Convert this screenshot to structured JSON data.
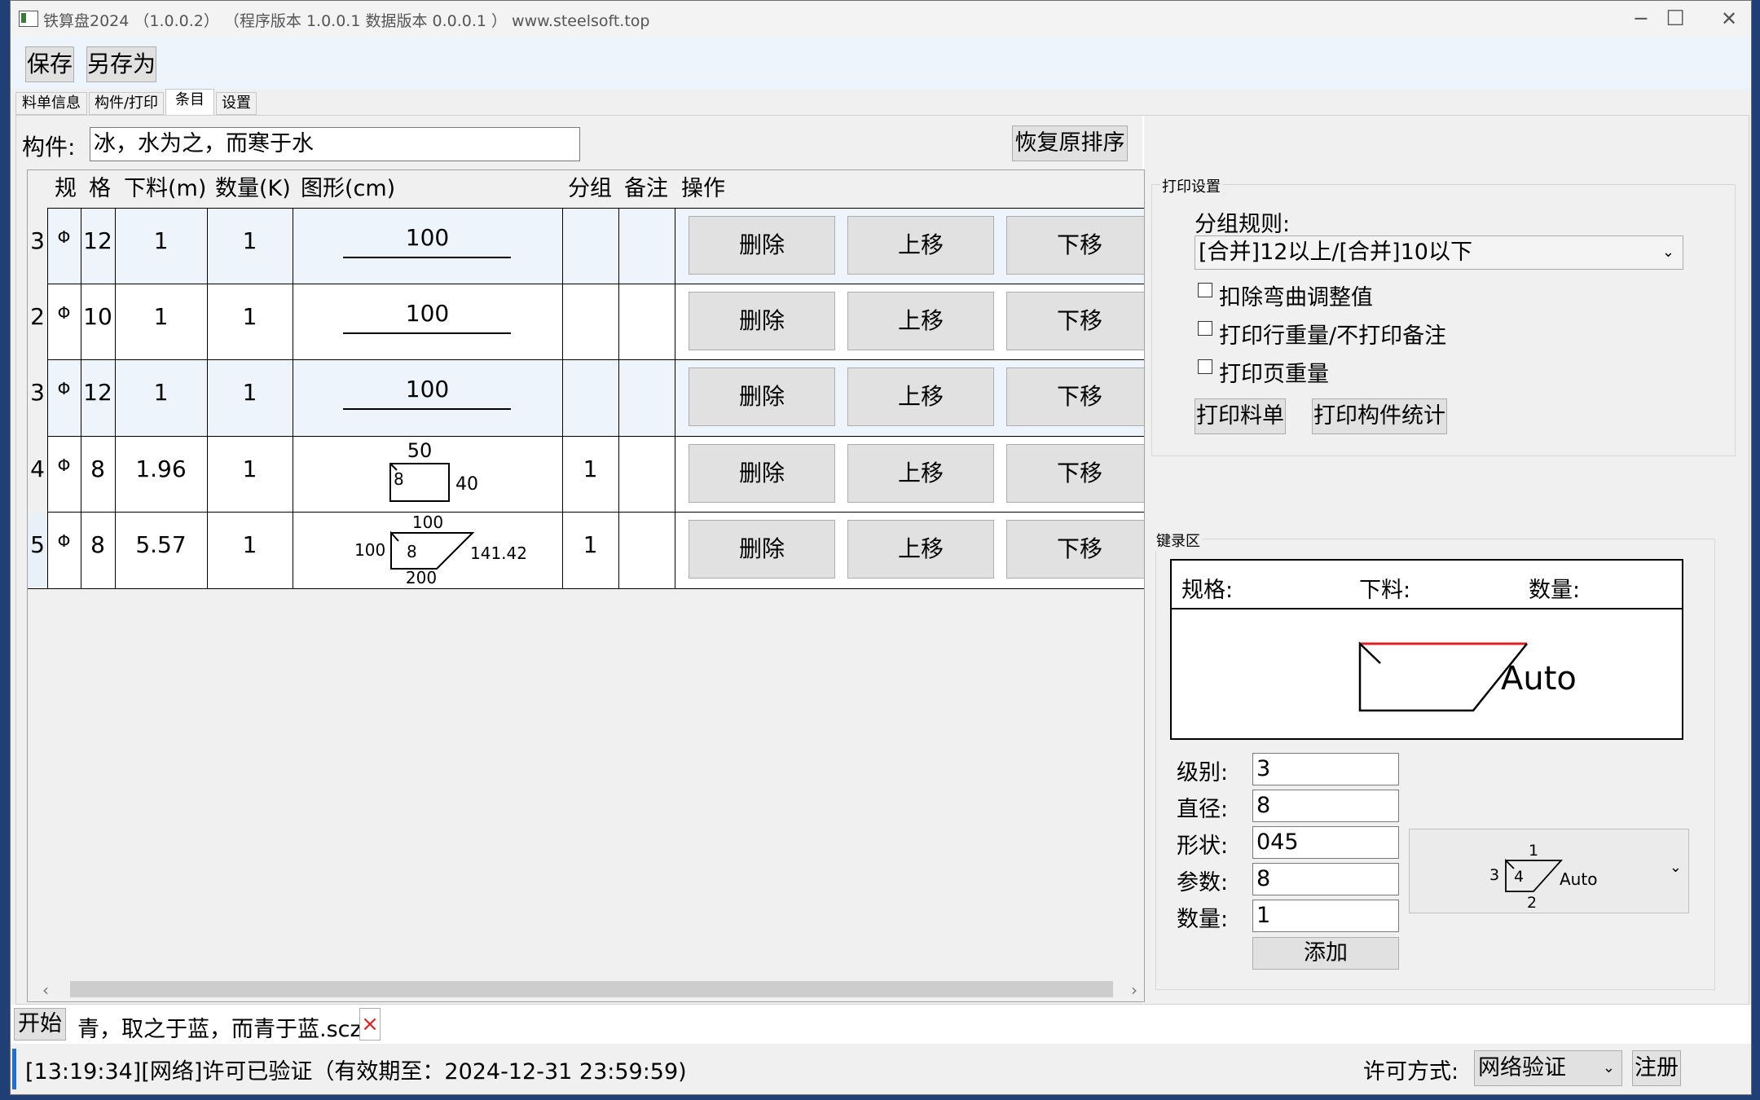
{
  "window": {
    "title": "铁算盘2024 （1.0.0.2）  （程序版本 1.0.0.1   数据版本 0.0.0.1 ）  www.steelsoft.top",
    "controls": [
      "─",
      "☐",
      "✕"
    ]
  },
  "toolbar": {
    "save_label": "保存",
    "save_as_label": "另存为"
  },
  "tabs": [
    {
      "label": "料单信息"
    },
    {
      "label": "构件/打印"
    },
    {
      "label": "条目"
    },
    {
      "label": "设置"
    }
  ],
  "component": {
    "label": "构件:",
    "value": "冰，水为之，而寒于水",
    "restore_label": "恢复原排序"
  },
  "table": {
    "headers": [
      "规",
      "格",
      "下料(m)",
      "数量(K)",
      "图形(cm)",
      "分组",
      "备注",
      "操作"
    ],
    "rows": [
      {
        "level": "3",
        "symbol": "Φ",
        "diameter": "12",
        "length": "1",
        "qty": "1",
        "shape_labels": [
          "100"
        ],
        "group": "",
        "note": ""
      },
      {
        "level": "2",
        "symbol": "Φ",
        "diameter": "10",
        "length": "1",
        "qty": "1",
        "shape_labels": [
          "100"
        ],
        "group": "",
        "note": ""
      },
      {
        "level": "3",
        "symbol": "Φ",
        "diameter": "12",
        "length": "1",
        "qty": "1",
        "shape_labels": [
          "100"
        ],
        "group": "",
        "note": ""
      },
      {
        "level": "4",
        "symbol": "Φ",
        "diameter": "8",
        "length": "1.96",
        "qty": "1",
        "shape_labels": [
          "50",
          "8",
          "40"
        ],
        "group": "1",
        "note": ""
      },
      {
        "level": "5",
        "symbol": "Φ",
        "diameter": "8",
        "length": "5.57",
        "qty": "1",
        "shape_labels": [
          "100",
          "100",
          "8",
          "141.42",
          "200"
        ],
        "group": "1",
        "note": ""
      }
    ],
    "row_actions": [
      "删除",
      "上移",
      "下移"
    ],
    "scroll_left": "‹",
    "scroll_right": "›"
  },
  "print_settings": {
    "title": "打印设置",
    "group_rule_label": "分组规则:",
    "group_rule_value": "[合并]12以上/[合并]10以下",
    "checkboxes": [
      {
        "label": "扣除弯曲调整值",
        "checked": false
      },
      {
        "label": "打印行重量/不打印备注",
        "checked": false
      },
      {
        "label": "打印页重量",
        "checked": false
      }
    ],
    "print_list_label": "打印料单",
    "print_stats_label": "打印构件统计"
  },
  "entry": {
    "title": "键录区",
    "preview_headers": [
      "规格:",
      "下料:",
      "数量:"
    ],
    "preview_shape_label": "Auto",
    "fields": [
      {
        "label": "级别:",
        "value": "3"
      },
      {
        "label": "直径:",
        "value": "8"
      },
      {
        "label": "形状:",
        "value": "045"
      },
      {
        "label": "参数:",
        "value": "8"
      },
      {
        "label": "数量:",
        "value": "1"
      }
    ],
    "add_label": "添加",
    "shape_picker_labels": [
      "1",
      "3",
      "4",
      "Auto",
      "2"
    ]
  },
  "doc_tabs": {
    "start_label": "开始",
    "file_label": "青，取之于蓝，而青于蓝.scz",
    "close": "×"
  },
  "status": {
    "message": "[13:19:34][网络]许可已验证（有效期至：2024-12-31 23:59:59)",
    "license_label": "许可方式:",
    "license_value": "网络验证",
    "register_label": "注册"
  },
  "colors": {
    "accent_line": "#e02020",
    "row_selected": "#eef4fb",
    "close_red": "#e02020"
  }
}
